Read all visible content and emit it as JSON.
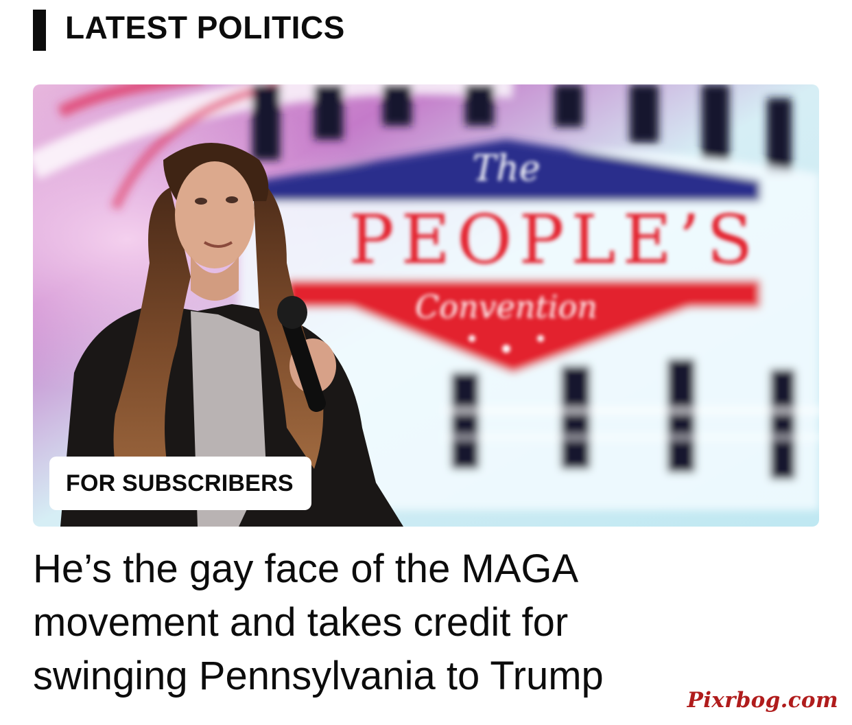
{
  "section": {
    "title": "LATEST POLITICS"
  },
  "article": {
    "badge_label": "FOR SUBSCRIBERS",
    "headline": "He’s the gay face of the MAGA movement and takes credit for swinging Pennsylvania to Trump",
    "image_sign_word": "PEOPLE’S",
    "image_sign_top": "The",
    "image_sign_bottom": "Convention"
  },
  "watermark": {
    "text": "Pixrbog.com"
  },
  "colors": {
    "text": "#0c0c0c",
    "sign_red": "#e3222d",
    "sign_blue": "#2a2f8c",
    "watermark": "#b01c1c"
  },
  "icons": {
    "image_subject": "person-with-microphone"
  }
}
